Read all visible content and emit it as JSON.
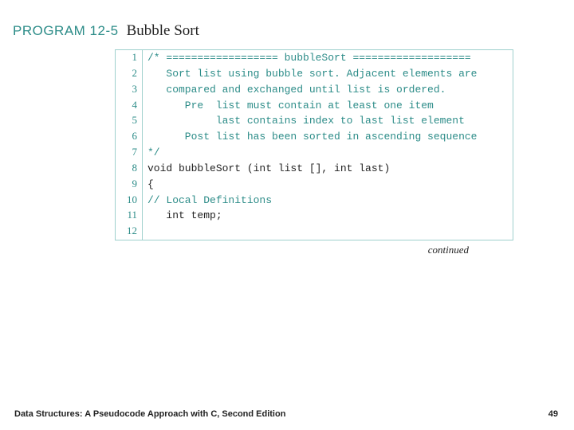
{
  "header": {
    "program_label": "PROGRAM 12-5",
    "program_title": "Bubble Sort"
  },
  "code": {
    "lines": [
      {
        "n": "1",
        "cls": "cmt",
        "text": "/* ================== bubbleSort ==================="
      },
      {
        "n": "2",
        "cls": "cmt",
        "text": "   Sort list using bubble sort. Adjacent elements are"
      },
      {
        "n": "3",
        "cls": "cmt",
        "text": "   compared and exchanged until list is ordered."
      },
      {
        "n": "4",
        "cls": "cmt",
        "text": "      Pre  list must contain at least one item"
      },
      {
        "n": "5",
        "cls": "cmt",
        "text": "           last contains index to last list element"
      },
      {
        "n": "6",
        "cls": "cmt",
        "text": "      Post list has been sorted in ascending sequence"
      },
      {
        "n": "7",
        "cls": "cmt",
        "text": "*/"
      },
      {
        "n": "8",
        "cls": "plain",
        "text": "void bubbleSort (int list [], int last)"
      },
      {
        "n": "9",
        "cls": "plain",
        "text": "{"
      },
      {
        "n": "10",
        "cls": "cmt",
        "text": "// Local Definitions"
      },
      {
        "n": "11",
        "cls": "plain",
        "text": "   int temp;"
      },
      {
        "n": "12",
        "cls": "plain",
        "text": " "
      }
    ]
  },
  "continued_label": "continued",
  "footer": {
    "left": "Data Structures: A Pseudocode Approach with C, Second Edition",
    "right": "49"
  }
}
